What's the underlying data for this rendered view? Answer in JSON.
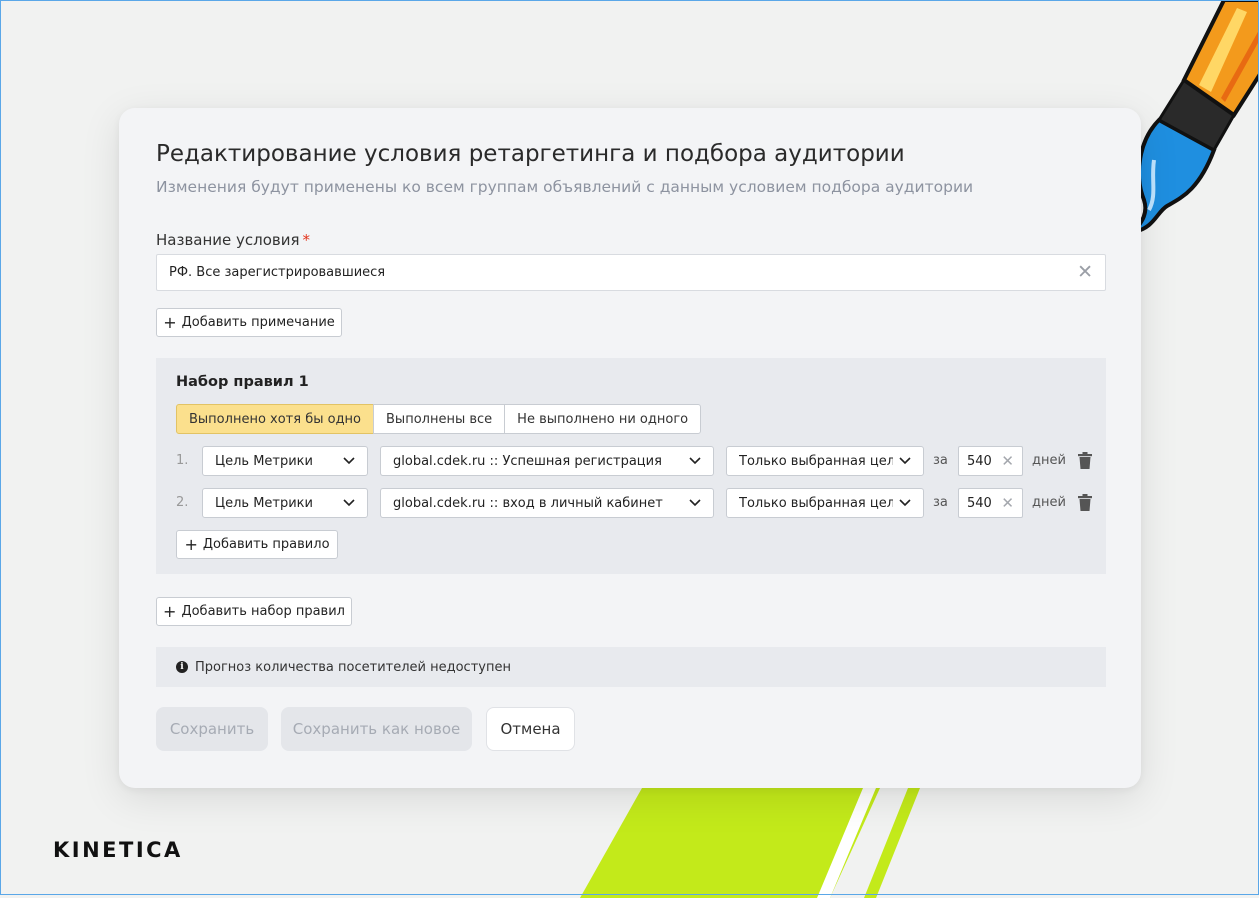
{
  "brand": {
    "logo_text": "KINETICA"
  },
  "dialog": {
    "title": "Редактирование условия ретаргетинга и подбора аудитории",
    "subtitle": "Изменения будут применены ко всем группам объявлений с данным условием подбора аудитории",
    "name_field": {
      "label": "Название условия",
      "required_mark": "*",
      "value": "РФ. Все зарегистрировавшиеся"
    },
    "add_note_label": "Добавить примечание",
    "ruleset": {
      "title": "Набор правил 1",
      "modes": [
        "Выполнено хотя бы одно",
        "Выполнены все",
        "Не выполнено ни одного"
      ],
      "active_mode": "Выполнено хотя бы одно",
      "rules": [
        {
          "num": "1.",
          "type": "Цель Метрики",
          "goal": "global.cdek.ru :: Успешная регистрация",
          "scope": "Только выбранная цель",
          "za": "за",
          "days": "540",
          "days_unit": "дней"
        },
        {
          "num": "2.",
          "type": "Цель Метрики",
          "goal": "global.cdek.ru :: вход в личный кабинет",
          "scope": "Только выбранная цель",
          "za": "за",
          "days": "540",
          "days_unit": "дней"
        }
      ],
      "add_rule_label": "Добавить правило"
    },
    "add_ruleset_label": "Добавить набор правил",
    "forecast_text": "Прогноз количества посетителей недоступен",
    "actions": {
      "save": "Сохранить",
      "save_new": "Сохранить как новое",
      "cancel": "Отмена"
    }
  },
  "colors": {
    "active_segment": "#fbe08d",
    "required_star": "#e2331b",
    "panel_bg": "#e8eaee",
    "accent_green": "#c3ea1a"
  }
}
